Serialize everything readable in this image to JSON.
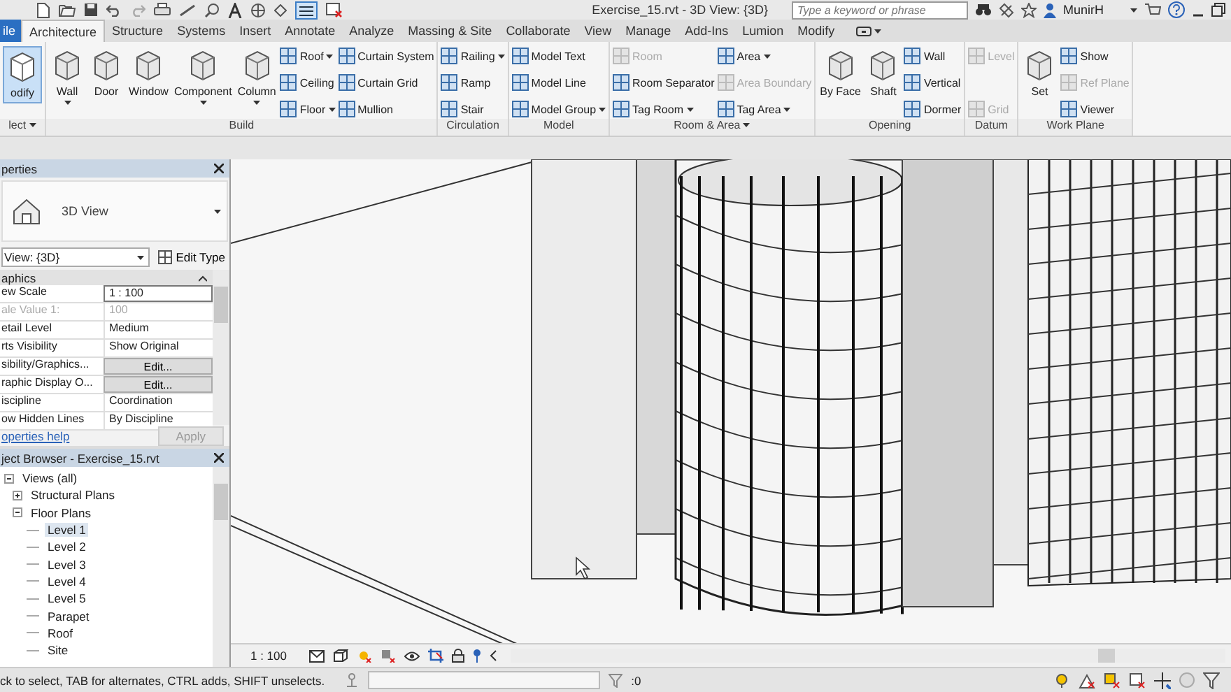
{
  "title_bar": {
    "title": "Exercise_15.rvt - 3D View: {3D}",
    "search": {
      "placeholder": "Type a keyword or phrase"
    },
    "user": "MunirH"
  },
  "tabs": [
    {
      "label": "ile",
      "kind": "file",
      "selected": false
    },
    {
      "label": "Architecture",
      "kind": "tab",
      "selected": true
    },
    {
      "label": "Structure",
      "kind": "tab",
      "selected": false
    },
    {
      "label": "Systems",
      "kind": "tab",
      "selected": false
    },
    {
      "label": "Insert",
      "kind": "tab",
      "selected": false
    },
    {
      "label": "Annotate",
      "kind": "tab",
      "selected": false
    },
    {
      "label": "Analyze",
      "kind": "tab",
      "selected": false
    },
    {
      "label": "Massing & Site",
      "kind": "tab",
      "selected": false
    },
    {
      "label": "Collaborate",
      "kind": "tab",
      "selected": false
    },
    {
      "label": "View",
      "kind": "tab",
      "selected": false
    },
    {
      "label": "Manage",
      "kind": "tab",
      "selected": false
    },
    {
      "label": "Add-Ins",
      "kind": "tab",
      "selected": false
    },
    {
      "label": "Lumion",
      "kind": "tab",
      "selected": false
    },
    {
      "label": "Modify",
      "kind": "tab",
      "selected": false
    }
  ],
  "ribbon": [
    {
      "title": "lect",
      "menu": true,
      "columns": [
        [
          {
            "label": "odify",
            "kind": "large",
            "selected": true,
            "dropdown": false,
            "disabled": false
          }
        ]
      ]
    },
    {
      "title": "Build",
      "menu": false,
      "columns": [
        [
          {
            "label": "Wall",
            "kind": "large",
            "selected": false,
            "dropdown": true,
            "disabled": false
          }
        ],
        [
          {
            "label": "Door",
            "kind": "large",
            "selected": false,
            "dropdown": false,
            "disabled": false
          }
        ],
        [
          {
            "label": "Window",
            "kind": "large",
            "selected": false,
            "dropdown": false,
            "disabled": false
          }
        ],
        [
          {
            "label": "Component",
            "kind": "large",
            "selected": false,
            "dropdown": true,
            "disabled": false
          }
        ],
        [
          {
            "label": "Column",
            "kind": "large",
            "selected": false,
            "dropdown": true,
            "disabled": false
          }
        ],
        [
          {
            "label": "Roof",
            "kind": "small",
            "selected": false,
            "dropdown": true,
            "disabled": false
          },
          {
            "label": "Ceiling",
            "kind": "small",
            "selected": false,
            "dropdown": false,
            "disabled": false
          },
          {
            "label": "Floor",
            "kind": "small",
            "selected": false,
            "dropdown": true,
            "disabled": false
          }
        ],
        [
          {
            "label": "Curtain System",
            "kind": "small",
            "selected": false,
            "dropdown": false,
            "disabled": false
          },
          {
            "label": "Curtain Grid",
            "kind": "small",
            "selected": false,
            "dropdown": false,
            "disabled": false
          },
          {
            "label": "Mullion",
            "kind": "small",
            "selected": false,
            "dropdown": false,
            "disabled": false
          }
        ]
      ]
    },
    {
      "title": "Circulation",
      "menu": false,
      "columns": [
        [
          {
            "label": "Railing",
            "kind": "small",
            "selected": false,
            "dropdown": true,
            "disabled": false
          },
          {
            "label": "Ramp",
            "kind": "small",
            "selected": false,
            "dropdown": false,
            "disabled": false
          },
          {
            "label": "Stair",
            "kind": "small",
            "selected": false,
            "dropdown": false,
            "disabled": false
          }
        ]
      ]
    },
    {
      "title": "Model",
      "menu": false,
      "columns": [
        [
          {
            "label": "Model Text",
            "kind": "small",
            "selected": false,
            "dropdown": false,
            "disabled": false
          },
          {
            "label": "Model Line",
            "kind": "small",
            "selected": false,
            "dropdown": false,
            "disabled": false
          },
          {
            "label": "Model Group",
            "kind": "small",
            "selected": false,
            "dropdown": true,
            "disabled": false
          }
        ]
      ]
    },
    {
      "title": "Room & Area",
      "menu": true,
      "columns": [
        [
          {
            "label": "Room",
            "kind": "small",
            "selected": false,
            "dropdown": false,
            "disabled": true
          },
          {
            "label": "Room Separator",
            "kind": "small",
            "selected": false,
            "dropdown": false,
            "disabled": false
          },
          {
            "label": "Tag Room",
            "kind": "small",
            "selected": false,
            "dropdown": true,
            "disabled": false
          }
        ],
        [
          {
            "label": "Area",
            "kind": "small",
            "selected": false,
            "dropdown": true,
            "disabled": false
          },
          {
            "label": "Area Boundary",
            "kind": "small",
            "selected": false,
            "dropdown": false,
            "disabled": true
          },
          {
            "label": "Tag Area",
            "kind": "small",
            "selected": false,
            "dropdown": true,
            "disabled": false
          }
        ]
      ]
    },
    {
      "title": "Opening",
      "menu": false,
      "columns": [
        [
          {
            "label": "By Face",
            "kind": "large",
            "selected": false,
            "dropdown": false,
            "disabled": false
          }
        ],
        [
          {
            "label": "Shaft",
            "kind": "large",
            "selected": false,
            "dropdown": false,
            "disabled": false
          }
        ],
        [
          {
            "label": "Wall",
            "kind": "small",
            "selected": false,
            "dropdown": false,
            "disabled": false
          },
          {
            "label": "Vertical",
            "kind": "small",
            "selected": false,
            "dropdown": false,
            "disabled": false
          },
          {
            "label": "Dormer",
            "kind": "small",
            "selected": false,
            "dropdown": false,
            "disabled": false
          }
        ]
      ]
    },
    {
      "title": "Datum",
      "menu": false,
      "columns": [
        [
          {
            "label": "Level",
            "kind": "small",
            "selected": false,
            "dropdown": false,
            "disabled": true
          },
          {
            "label": "Grid",
            "kind": "small",
            "selected": false,
            "dropdown": false,
            "disabled": true
          }
        ]
      ]
    },
    {
      "title": "Work Plane",
      "menu": false,
      "columns": [
        [
          {
            "label": "Set",
            "kind": "large",
            "selected": false,
            "dropdown": false,
            "disabled": false
          }
        ],
        [
          {
            "label": "Show",
            "kind": "small",
            "selected": false,
            "dropdown": false,
            "disabled": false
          },
          {
            "label": "Ref Plane",
            "kind": "small",
            "selected": false,
            "dropdown": false,
            "disabled": true
          },
          {
            "label": "Viewer",
            "kind": "small",
            "selected": false,
            "dropdown": false,
            "disabled": false
          }
        ]
      ]
    }
  ],
  "properties": {
    "title": "perties",
    "type_name": "3D View",
    "instance": "View: {3D}",
    "edit_type": "Edit Type",
    "group": "aphics",
    "rows": [
      {
        "label": "ew Scale",
        "value": "1 : 100",
        "kind": "input",
        "disabled": false
      },
      {
        "label": "ale Value    1:",
        "value": "100",
        "kind": "text",
        "disabled": true
      },
      {
        "label": "etail Level",
        "value": "Medium",
        "kind": "text",
        "disabled": false
      },
      {
        "label": "rts Visibility",
        "value": "Show Original",
        "kind": "text",
        "disabled": false
      },
      {
        "label": "sibility/Graphics...",
        "value": "Edit...",
        "kind": "button",
        "disabled": false
      },
      {
        "label": "raphic Display O...",
        "value": "Edit...",
        "kind": "button",
        "disabled": false
      },
      {
        "label": "iscipline",
        "value": "Coordination",
        "kind": "text",
        "disabled": false
      },
      {
        "label": "ow Hidden Lines",
        "value": "By Discipline",
        "kind": "text",
        "disabled": false
      }
    ],
    "help": "operties help",
    "apply": "Apply"
  },
  "browser": {
    "title": "ject Browser - Exercise_15.rvt",
    "tree": [
      {
        "label": "Views (all)",
        "expanded": true,
        "selected": false,
        "children": [
          {
            "label": "Structural Plans",
            "expanded": false,
            "selected": false
          },
          {
            "label": "Floor Plans",
            "expanded": true,
            "selected": false,
            "children": [
              {
                "label": "Level 1",
                "selected": true
              },
              {
                "label": "Level 2",
                "selected": false
              },
              {
                "label": "Level 3",
                "selected": false
              },
              {
                "label": "Level 4",
                "selected": false
              },
              {
                "label": "Level 5",
                "selected": false
              },
              {
                "label": "Parapet",
                "selected": false
              },
              {
                "label": "Roof",
                "selected": false
              },
              {
                "label": "Site",
                "selected": false
              }
            ]
          }
        ]
      }
    ]
  },
  "view_bar": {
    "scale": "1 : 100"
  },
  "status_bar": {
    "message": "ck to select, TAB for alternates, CTRL adds, SHIFT unselects.",
    "selection_count": ":0"
  }
}
